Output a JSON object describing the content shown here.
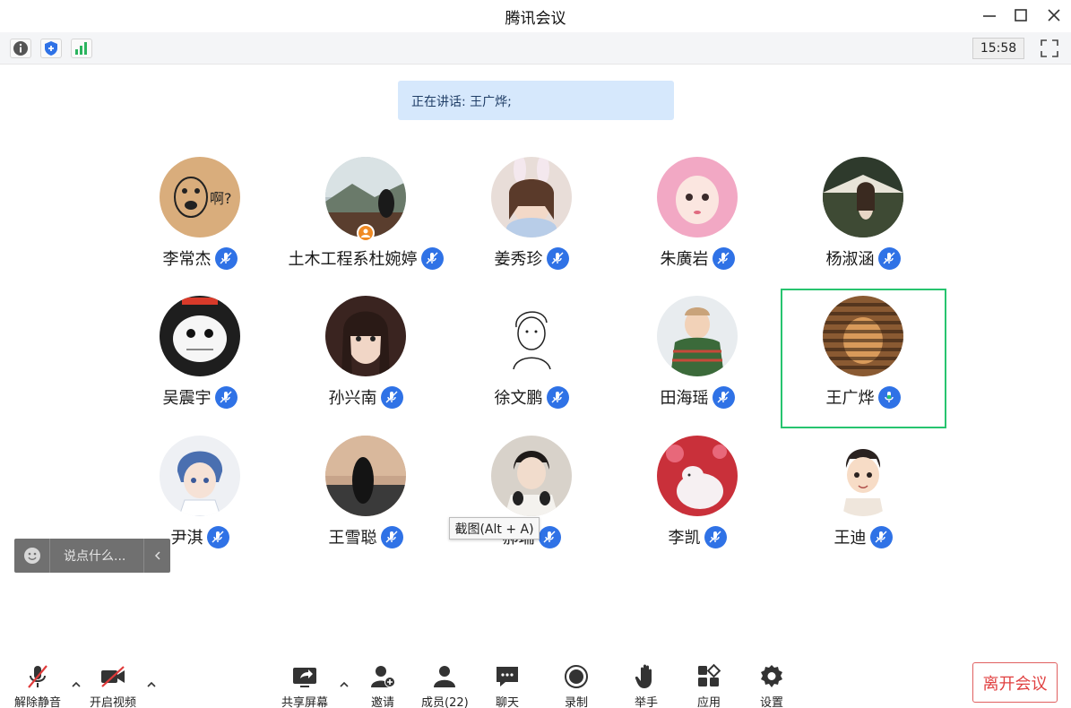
{
  "window": {
    "title": "腾讯会议"
  },
  "toolbar": {
    "clock": "15:58"
  },
  "banner": {
    "speaking": "正在讲话: 王广烨;"
  },
  "participants": [
    {
      "name": "李常杰",
      "avatar": "cartoon-face",
      "mic": "on"
    },
    {
      "name": "土木工程系杜婉婷",
      "avatar": "landscape-girl",
      "mic": "on",
      "host": true
    },
    {
      "name": "姜秀珍",
      "avatar": "girl-bunny-ears",
      "mic": "on"
    },
    {
      "name": "朱廣岩",
      "avatar": "girl-pink-hood",
      "mic": "on"
    },
    {
      "name": "杨淑涵",
      "avatar": "girl-tent",
      "mic": "on"
    },
    {
      "name": "吴震宇",
      "avatar": "cat-cartoon",
      "mic": "on"
    },
    {
      "name": "孙兴南",
      "avatar": "girl-portrait",
      "mic": "on"
    },
    {
      "name": "徐文鹏",
      "avatar": "line-sketch",
      "mic": "on"
    },
    {
      "name": "田海瑶",
      "avatar": "child-sweater",
      "mic": "on"
    },
    {
      "name": "王广烨",
      "avatar": "blinds-portrait",
      "mic": "speaking"
    },
    {
      "name": "尹淇",
      "avatar": "anime-boy",
      "mic": "on"
    },
    {
      "name": "王雪聪",
      "avatar": "silhouette-sunset",
      "mic": "on"
    },
    {
      "name": "郝瑞",
      "avatar": "boy-headphones",
      "mic": "on"
    },
    {
      "name": "李凯",
      "avatar": "cat-toy",
      "mic": "on"
    },
    {
      "name": "王迪",
      "avatar": "cartoon-boy",
      "mic": "on"
    }
  ],
  "chat": {
    "placeholder": "说点什么..."
  },
  "tooltip": {
    "text": "截图(Alt + A)"
  },
  "bottom": {
    "unmute": "解除静音",
    "video": "开启视频",
    "share": "共享屏幕",
    "invite": "邀请",
    "members": "成员(22)",
    "chat": "聊天",
    "record": "录制",
    "raise_hand": "举手",
    "apps": "应用",
    "settings": "设置",
    "leave": "离开会议"
  },
  "colors": {
    "accent": "#2f72e6",
    "speaking": "#27c46f",
    "leave": "#e04040",
    "banner": "#d6e8fc"
  }
}
